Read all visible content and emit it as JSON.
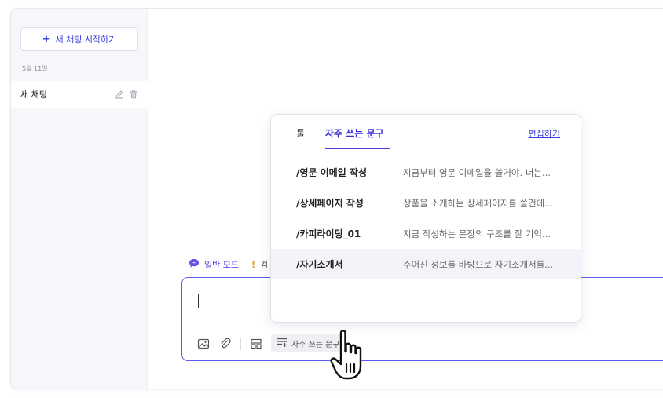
{
  "sidebar": {
    "new_chat_label": "새 채팅 시작하기",
    "date_group": "5월 11일",
    "chats": [
      {
        "title": "새 채팅"
      }
    ]
  },
  "mode_row": {
    "mode_label": "일반 모드",
    "warn_mark": "!",
    "search_label": "검"
  },
  "composer": {
    "phrase_button_label": "자주 쓰는 문구"
  },
  "popup": {
    "tabs": [
      {
        "label": "툴",
        "selected": false
      },
      {
        "label": "자주 쓰는 문구",
        "selected": true
      }
    ],
    "edit_label": "편집하기",
    "items": [
      {
        "name": "/영문 이메일 작성",
        "preview": "지금부터 영문 이메일을 쓸거야. 너는...",
        "hovered": false
      },
      {
        "name": "/상세페이지 작성",
        "preview": "상품을 소개하는 상세페이지를 쓸건데...",
        "hovered": false
      },
      {
        "name": "/카피라이팅_01",
        "preview": "지금 작성하는 문장의 구조를 잘 기억...",
        "hovered": false
      },
      {
        "name": "/자기소개서",
        "preview": "주어진 정보를 바탕으로 자기소개서를...",
        "hovered": true
      }
    ]
  },
  "colors": {
    "accent": "#4a3bd6",
    "input_border": "#5b5ef0",
    "sidebar_bg": "#f5f7fb"
  }
}
